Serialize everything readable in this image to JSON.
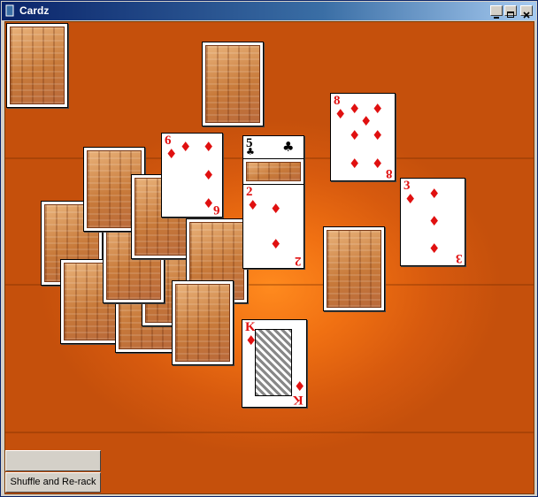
{
  "window": {
    "title": "Cardz"
  },
  "titlebar_buttons": {
    "minimize_icon": "minimize-icon",
    "maximize_icon": "maximize-icon",
    "close_icon": "close-icon"
  },
  "cards_face_up": [
    {
      "rank": "6",
      "suit": "diamonds"
    },
    {
      "rank": "5",
      "suit": "clubs"
    },
    {
      "rank": "8",
      "suit": "diamonds"
    },
    {
      "rank": "2",
      "suit": "diamonds"
    },
    {
      "rank": "3",
      "suit": "diamonds"
    },
    {
      "rank": "K",
      "suit": "diamonds"
    }
  ],
  "suit_symbols": {
    "diamonds": "♦",
    "clubs": "♣"
  },
  "colors": {
    "table": "#e0640f",
    "red_suit": "#e01010",
    "black_suit": "#000000"
  },
  "buttons": {
    "shuffle_label": "Shuffle and Re-rack"
  }
}
